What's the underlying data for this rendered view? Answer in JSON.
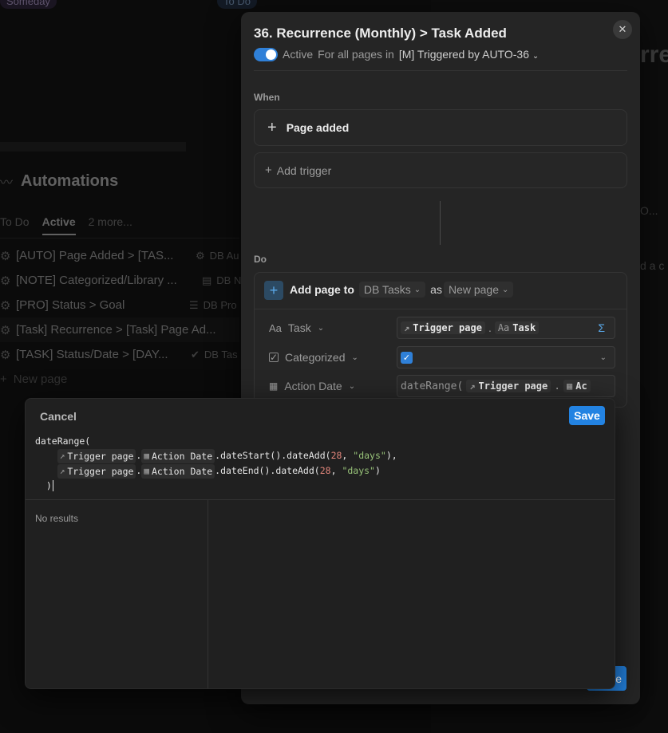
{
  "background": {
    "status_someday": "Someday",
    "status_todo": "To Do",
    "automations_title": "Automations",
    "tabs": [
      {
        "label": "To Do"
      },
      {
        "label": "Active"
      },
      {
        "label": "2 more..."
      }
    ],
    "rows": [
      {
        "name": "[AUTO] Page Added > [TAS...",
        "prop": "DB Au"
      },
      {
        "name": "[NOTE] Categorized/Library ...",
        "prop": "DB N"
      },
      {
        "name": "[PRO] Status > Goal",
        "prop": "DB Pro"
      },
      {
        "name": "[Task] Recurrence > [Task] Page Ad...",
        "prop": ""
      },
      {
        "name": "[TASK] Status/Date > [DAY...",
        "prop": "DB Tas"
      }
    ],
    "new_page": "New page",
    "right_snippets": [
      "rre",
      "O...",
      "d a c"
    ]
  },
  "modal": {
    "title": "36. Recurrence (Monthly) > Task Added",
    "active_label": "Active",
    "scope_label": "For all pages in",
    "scope_value": "[M] Triggered by AUTO-36",
    "when_label": "When",
    "trigger_label": "Page added",
    "add_trigger_label": "Add trigger",
    "do_label": "Do",
    "action": {
      "add_page_to": "Add page to",
      "database": "DB Tasks",
      "as_label": "as",
      "as_value": "New page"
    },
    "properties": [
      {
        "name": "Task",
        "icon": "Aa"
      },
      {
        "name": "Categorized",
        "icon": "checkbox-icon"
      },
      {
        "name": "Action Date",
        "icon": "calendar-icon"
      }
    ],
    "task_value": {
      "trigger": "Trigger page",
      "prop": "Task",
      "prop_icon": "Aa"
    },
    "action_date_value": {
      "fn": "dateRange(",
      "trigger": "Trigger page",
      "prop": "Ac"
    }
  },
  "editor": {
    "cancel_label": "Cancel",
    "save_label": "Save",
    "code": {
      "line1": "dateRange(",
      "trigger": "Trigger page",
      "dot": ".",
      "prop": "Action Date",
      "start_fn": ".dateStart().dateAdd(",
      "end_fn": ".dateEnd().dateAdd(",
      "num": "28",
      "comma": ", ",
      "unit": "\"days\"",
      "close1": "),",
      "close2": ")",
      "last": ")"
    },
    "no_results": "No results"
  },
  "colors": {
    "accent": "#2383e2",
    "toggle": "#2f80d8"
  }
}
